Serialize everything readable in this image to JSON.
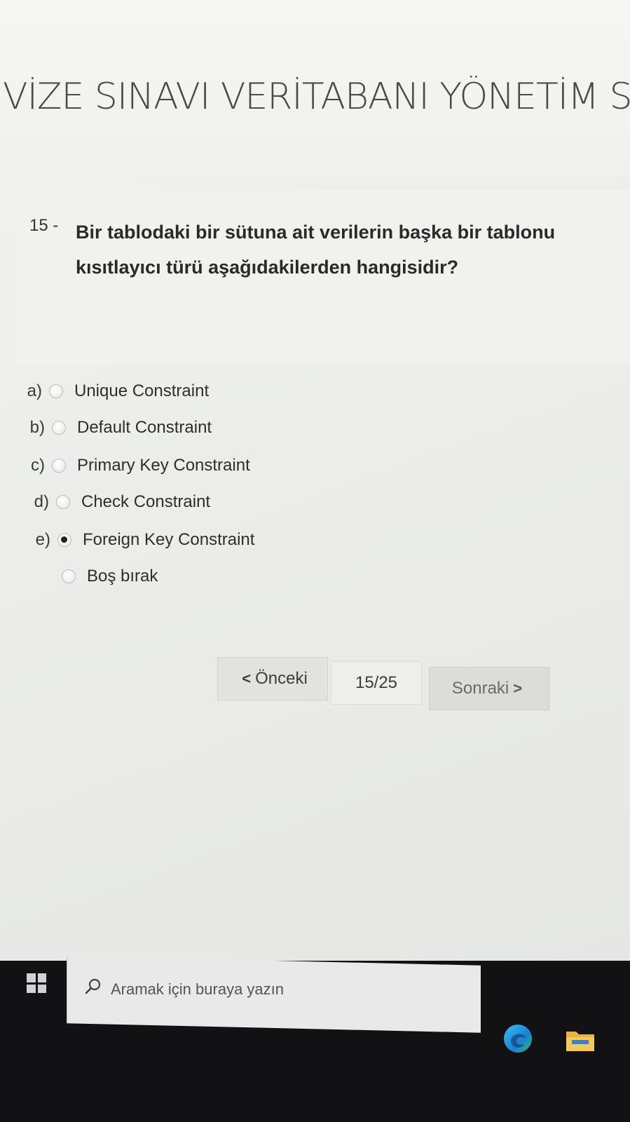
{
  "header": {
    "exam_title": "VİZE SINAVI VERİTABANI YÖNETİM S"
  },
  "question": {
    "number": "15 -",
    "text_line1": "Bir tablodaki bir sütuna ait verilerin başka bir tablonu",
    "text_line2": "kısıtlayıcı türü aşağıdakilerden hangisidir?"
  },
  "options": [
    {
      "letter": "a)",
      "label": "Unique Constraint",
      "selected": false
    },
    {
      "letter": "b)",
      "label": "Default Constraint",
      "selected": false
    },
    {
      "letter": "c)",
      "label": "Primary Key Constraint",
      "selected": false
    },
    {
      "letter": "d)",
      "label": "Check Constraint",
      "selected": false
    },
    {
      "letter": "e)",
      "label": "Foreign Key Constraint",
      "selected": true
    },
    {
      "letter": "",
      "label": "Boş bırak",
      "selected": false
    }
  ],
  "pager": {
    "prev_label": "Önceki",
    "page_indicator": "15/25",
    "next_label": "Sonraki"
  },
  "taskbar": {
    "search_placeholder": "Aramak için buraya yazın",
    "icons": [
      "windows-start-icon",
      "search-icon",
      "edge-browser-icon",
      "file-explorer-icon"
    ]
  }
}
